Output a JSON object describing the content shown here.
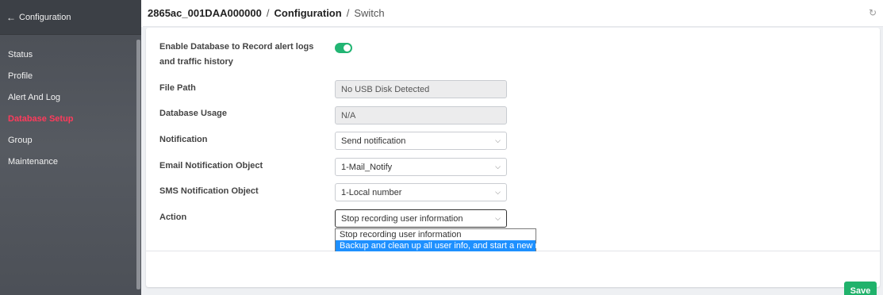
{
  "sidebar": {
    "back_label": "Configuration",
    "items": [
      {
        "label": "Status"
      },
      {
        "label": "Profile"
      },
      {
        "label": "Alert And Log"
      },
      {
        "label": "Database Setup"
      },
      {
        "label": "Group"
      },
      {
        "label": "Maintenance"
      }
    ],
    "active_color": "#ff3b5c"
  },
  "header": {
    "device": "2865ac_001DAA000000",
    "separator": "/",
    "section": "Configuration",
    "page": "Switch"
  },
  "form": {
    "enable_db_label": "Enable Database to Record alert logs and traffic history",
    "enable_db_on": true,
    "file_path_label": "File Path",
    "file_path_value": "No USB Disk Detected",
    "db_usage_label": "Database Usage",
    "db_usage_value": "N/A",
    "notification_label": "Notification",
    "notification_value": "Send notification",
    "email_label": "Email Notification Object",
    "email_value": "1-Mail_Notify",
    "sms_label": "SMS Notification Object",
    "sms_value": "1-Local number",
    "action_label": "Action",
    "action_value": "Stop recording user information",
    "action_options": [
      "Stop recording user information",
      "Backup and clean up all user info, and start a new record"
    ],
    "action_highlighted_index": 1
  },
  "buttons": {
    "save_label": "Save"
  },
  "colors": {
    "accent_green": "#20b26b",
    "toggle_green": "#22b573",
    "selection_blue": "#1e90ff"
  }
}
